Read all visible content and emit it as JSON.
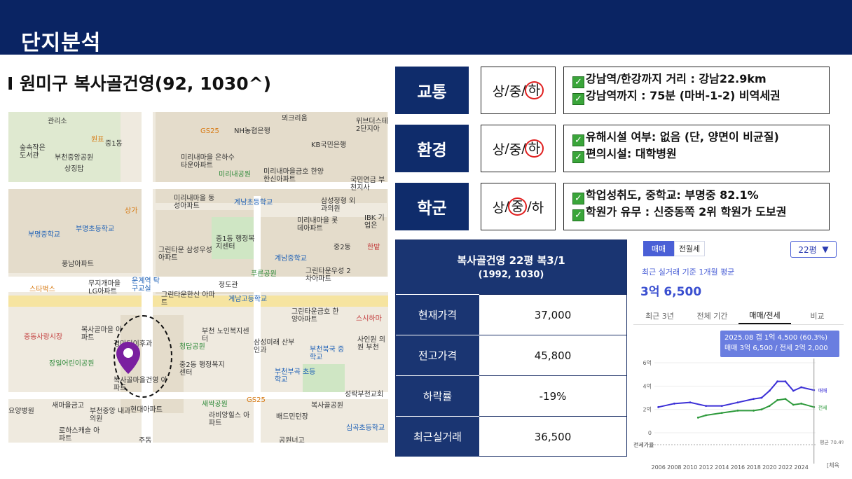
{
  "header": {
    "title": "단지분석"
  },
  "complex_title": "I 원미구 복사골건영(92, 1030^)",
  "map": {
    "labels": [
      "관리소",
      "숲속작은 도서관",
      "원표",
      "중1동",
      "부천중앙공원",
      "상징탑",
      "GS25",
      "NH농협은행",
      "미리내마을 은하수타운아파트",
      "미리내공원",
      "미리내마을금호 한양한신아파트",
      "KB국민은행",
      "국민연금 부천지사",
      "위브더스테 2단지아",
      "뫼크리움",
      "미리내마을 동성아파트",
      "계남초등학교",
      "삼성정형 외과의원",
      "IBK 기업은",
      "상가",
      "부명초등학교",
      "부명중학교",
      "중1동 행정복지센터",
      "미리내마을 롯데아파트",
      "중2동",
      "한밭",
      "풍남아파트",
      "그린타운 삼성우성아파트",
      "계남중학교",
      "그린타운우성 2차아파트",
      "무지개마을 LG아파트",
      "운계역 탁구교실",
      "푸른공원",
      "스타벅스",
      "정도관",
      "그린타운한신 아파트",
      "계남고등학교",
      "그린타운금호 한양아파트",
      "스시하마",
      "복사골마을 아파트",
      "부천 노인복지센터",
      "삼성미래 산부인과",
      "사인원 의원 부천",
      "중동사랑시장",
      "경마디이후과",
      "청답공원",
      "부천북국 중학교",
      "장일어린이공원",
      "중2동 행정복지센터",
      "부천부곡 초등학교",
      "복사골마을건영 아파트",
      "새마을금고",
      "새싹공원",
      "GS25",
      "복사골공원",
      "성락부천교회",
      "요양병원",
      "부천중앙 내과의원",
      "현대아파트",
      "라비앙힐스 아파트",
      "배드민턴장",
      "심곡초등학교",
      "로하스캐슬 아파트",
      "주동",
      "공원너고"
    ]
  },
  "criteria": [
    {
      "label": "교통",
      "grade": {
        "high": "상",
        "mid": "중",
        "low": "하",
        "selected": "하"
      },
      "lines": [
        "강남역/한강까지 거리 : 강남22.9km",
        "강남역까지 : 75분 (마버-1-2) 비역세권"
      ]
    },
    {
      "label": "환경",
      "grade": {
        "high": "상",
        "mid": "중",
        "low": "하",
        "selected": "하"
      },
      "lines": [
        "유해시설 여부: 없음 (단, 양면이 비균질)",
        "편의시설: 대학병원"
      ]
    },
    {
      "label": "학군",
      "grade": {
        "high": "상",
        "mid": "중",
        "low": "하",
        "selected": "중"
      },
      "lines": [
        "학업성취도, 중학교:  부명중 82.1%",
        "학원가 유무 : 신중동쪽 2위 학원가 도보권"
      ]
    }
  ],
  "price_table": {
    "title": "복사골건영 22평 복3/1",
    "subtitle": "(1992, 1030)",
    "rows": [
      {
        "key": "현재가격",
        "value": "37,000"
      },
      {
        "key": "전고가격",
        "value": "45,800"
      },
      {
        "key": "하락률",
        "value": "-19%"
      },
      {
        "key": "최근실거래",
        "value": "36,500"
      }
    ]
  },
  "price_widget": {
    "tabs": [
      "매매",
      "전월세"
    ],
    "size_select": "22평",
    "subtitle": "최근 실거래 기준 1개월 평균",
    "avg_price": "3억 6,500",
    "period_tabs": [
      "최근 3년",
      "전체 기간",
      "매매/전세",
      "비교"
    ],
    "active_period_tab": "매매/전세",
    "tooltip_line1": "2025.08  갭 1억 4,500 (60.3%)",
    "tooltip_line2": "매매 3억 6,500 / 전세 2억 2,000",
    "colors": {
      "sale": "#3b2fd6",
      "jeonse": "#2e9a3c",
      "ratio": "#888888"
    }
  },
  "chart_data": {
    "type": "line",
    "xlabel": "",
    "ylabel": "",
    "x_tick_labels": [
      "2006",
      "2008",
      "2010",
      "2012",
      "2014",
      "2016",
      "2018",
      "2020",
      "2022",
      "2024"
    ],
    "y_tick_labels": [
      "0",
      "2억",
      "4억",
      "6억"
    ],
    "ylim": [
      0,
      6
    ],
    "series": [
      {
        "name": "매매",
        "x": [
          2006,
          2008,
          2010,
          2012,
          2014,
          2016,
          2018,
          2019,
          2020,
          2021,
          2022,
          2023,
          2024,
          2025.6
        ],
        "values": [
          2.2,
          2.5,
          2.6,
          2.3,
          2.3,
          2.6,
          2.9,
          3.0,
          3.6,
          4.4,
          4.4,
          3.6,
          3.9,
          3.65
        ]
      },
      {
        "name": "전세",
        "x": [
          2011,
          2012,
          2014,
          2016,
          2018,
          2019,
          2020,
          2021,
          2022,
          2023,
          2024,
          2025.6
        ],
        "values": [
          1.3,
          1.5,
          1.7,
          1.9,
          1.9,
          2.0,
          2.3,
          2.8,
          2.9,
          2.4,
          2.5,
          2.2
        ]
      }
    ],
    "ratio_label": "전세가율",
    "ratio_value_label": "평균 70.4%",
    "footer": "[체육"
  }
}
